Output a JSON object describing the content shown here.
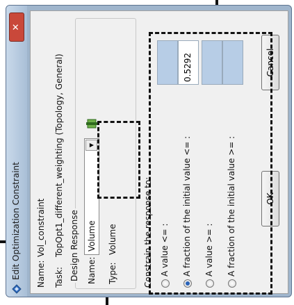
{
  "window": {
    "title": "Edit Optimization Constraint",
    "close_glyph": "✕"
  },
  "name_row": {
    "label": "Name:",
    "value": "Vol_constraint"
  },
  "task_row": {
    "label": "Task:",
    "value": "TopOpt1_different_weighting (Topology, General)"
  },
  "design_response": {
    "title": "Design Response",
    "name_label": "Name:",
    "name_value": "Volume",
    "type_label": "Type:",
    "type_value": "Volume",
    "edit_icon": "edit-pencil-icon"
  },
  "constrain": {
    "label": "Constrain the response to:",
    "options": [
      {
        "label": "A value <= :",
        "selected": false,
        "value": ""
      },
      {
        "label": "A fraction of the initial value <= :",
        "selected": true,
        "value": "0.5292"
      },
      {
        "label": "A value >= :",
        "selected": false,
        "value": ""
      },
      {
        "label": "A fraction of the initial value >= :",
        "selected": false,
        "value": ""
      }
    ]
  },
  "buttons": {
    "ok": "OK",
    "cancel": "Cancel"
  },
  "colors": {
    "title_bar": "#a9bfd7",
    "disabled_field": "#b7cde6",
    "annotation": "#111111"
  }
}
